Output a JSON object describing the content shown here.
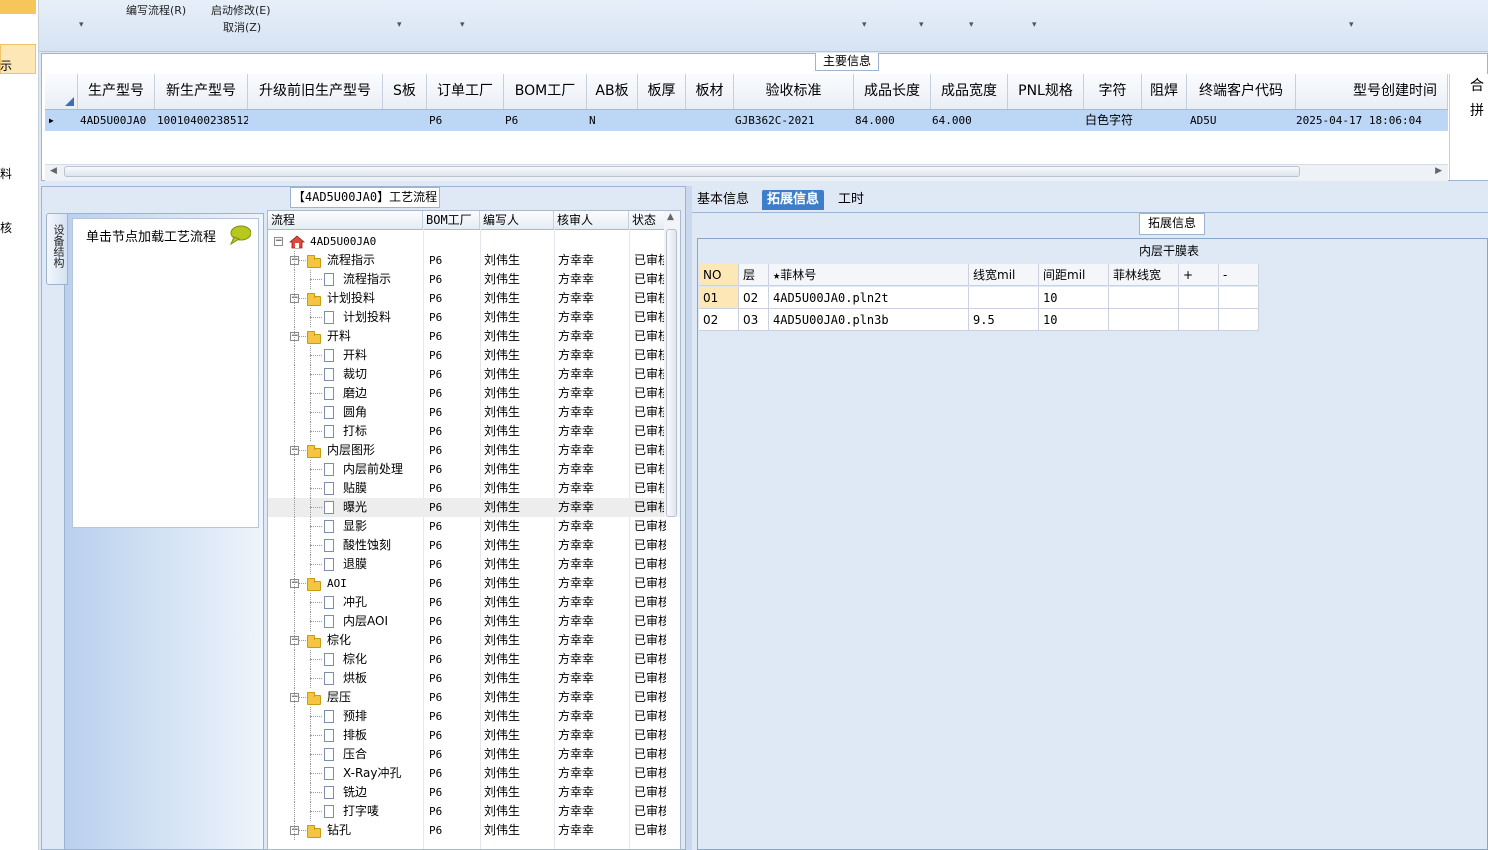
{
  "left_strip": {
    "items": [
      "示",
      "料",
      "核"
    ]
  },
  "ribbon": {
    "write_flow": "编写流程(R)",
    "start_modify": "启动修改(E)",
    "cancel": "取消(Z)"
  },
  "main_info": {
    "title": "主要信息",
    "columns": [
      "生产型号",
      "新生产型号",
      "升级前旧生产型号",
      "S板",
      "订单工厂",
      "BOM工厂",
      "AB板",
      "板厚",
      "板材",
      "验收标准",
      "成品长度",
      "成品宽度",
      "PNL规格",
      "字符",
      "阻焊",
      "终端客户代码",
      "型号创建时间",
      "合拼"
    ],
    "row": {
      "prod_model": "4AD5U00JA0",
      "new_model": "10010400238512",
      "old_model": "",
      "s_board": "",
      "order_factory": "P6",
      "bom_factory": "P6",
      "ab_board": "N",
      "thickness": "",
      "material": "",
      "standard": "GJB362C-2021",
      "length": "84.000",
      "width": "64.000",
      "pnl": "",
      "char": "白色字符",
      "solder": "",
      "customer_code": "AD5U",
      "created": "2025-04-17 18:06:04"
    }
  },
  "flow_panel": {
    "title": "【4AD5U00JA0】工艺流程",
    "vertical_tab": "设备结构",
    "nav_hint": "单击节点加载工艺流程",
    "columns": [
      "流程",
      "BOM工厂",
      "编写人",
      "核审人",
      "状态"
    ],
    "rows": [
      {
        "level": 0,
        "type": "root",
        "name": "4AD5U00JA0",
        "bom": "",
        "writer": "",
        "reviewer": "",
        "status": ""
      },
      {
        "level": 1,
        "type": "folder",
        "name": "流程指示",
        "bom": "P6",
        "writer": "刘伟生",
        "reviewer": "方幸幸",
        "status": "已审核"
      },
      {
        "level": 2,
        "type": "doc",
        "name": "流程指示",
        "bom": "P6",
        "writer": "刘伟生",
        "reviewer": "方幸幸",
        "status": "已审核"
      },
      {
        "level": 1,
        "type": "folder",
        "name": "计划投料",
        "bom": "P6",
        "writer": "刘伟生",
        "reviewer": "方幸幸",
        "status": "已审核"
      },
      {
        "level": 2,
        "type": "doc",
        "name": "计划投料",
        "bom": "P6",
        "writer": "刘伟生",
        "reviewer": "方幸幸",
        "status": "已审核"
      },
      {
        "level": 1,
        "type": "folder",
        "name": "开料",
        "bom": "P6",
        "writer": "刘伟生",
        "reviewer": "方幸幸",
        "status": "已审核"
      },
      {
        "level": 2,
        "type": "doc",
        "name": "开料",
        "bom": "P6",
        "writer": "刘伟生",
        "reviewer": "方幸幸",
        "status": "已审核"
      },
      {
        "level": 2,
        "type": "doc",
        "name": "裁切",
        "bom": "P6",
        "writer": "刘伟生",
        "reviewer": "方幸幸",
        "status": "已审核"
      },
      {
        "level": 2,
        "type": "doc",
        "name": "磨边",
        "bom": "P6",
        "writer": "刘伟生",
        "reviewer": "方幸幸",
        "status": "已审核"
      },
      {
        "level": 2,
        "type": "doc",
        "name": "圆角",
        "bom": "P6",
        "writer": "刘伟生",
        "reviewer": "方幸幸",
        "status": "已审核"
      },
      {
        "level": 2,
        "type": "doc",
        "name": "打标",
        "bom": "P6",
        "writer": "刘伟生",
        "reviewer": "方幸幸",
        "status": "已审核"
      },
      {
        "level": 1,
        "type": "folder",
        "name": "内层图形",
        "bom": "P6",
        "writer": "刘伟生",
        "reviewer": "方幸幸",
        "status": "已审核"
      },
      {
        "level": 2,
        "type": "doc",
        "name": "内层前处理",
        "bom": "P6",
        "writer": "刘伟生",
        "reviewer": "方幸幸",
        "status": "已审核"
      },
      {
        "level": 2,
        "type": "doc",
        "name": "贴膜",
        "bom": "P6",
        "writer": "刘伟生",
        "reviewer": "方幸幸",
        "status": "已审核"
      },
      {
        "level": 2,
        "type": "doc",
        "name": "曝光",
        "bom": "P6",
        "writer": "刘伟生",
        "reviewer": "方幸幸",
        "status": "已审核",
        "selected": true
      },
      {
        "level": 2,
        "type": "doc",
        "name": "显影",
        "bom": "P6",
        "writer": "刘伟生",
        "reviewer": "方幸幸",
        "status": "已审核"
      },
      {
        "level": 2,
        "type": "doc",
        "name": "酸性蚀刻",
        "bom": "P6",
        "writer": "刘伟生",
        "reviewer": "方幸幸",
        "status": "已审核"
      },
      {
        "level": 2,
        "type": "doc",
        "name": "退膜",
        "bom": "P6",
        "writer": "刘伟生",
        "reviewer": "方幸幸",
        "status": "已审核"
      },
      {
        "level": 1,
        "type": "folder",
        "name": "AOI",
        "bom": "P6",
        "writer": "刘伟生",
        "reviewer": "方幸幸",
        "status": "已审核"
      },
      {
        "level": 2,
        "type": "doc",
        "name": "冲孔",
        "bom": "P6",
        "writer": "刘伟生",
        "reviewer": "方幸幸",
        "status": "已审核"
      },
      {
        "level": 2,
        "type": "doc",
        "name": "内层AOI",
        "bom": "P6",
        "writer": "刘伟生",
        "reviewer": "方幸幸",
        "status": "已审核"
      },
      {
        "level": 1,
        "type": "folder",
        "name": "棕化",
        "bom": "P6",
        "writer": "刘伟生",
        "reviewer": "方幸幸",
        "status": "已审核"
      },
      {
        "level": 2,
        "type": "doc",
        "name": "棕化",
        "bom": "P6",
        "writer": "刘伟生",
        "reviewer": "方幸幸",
        "status": "已审核"
      },
      {
        "level": 2,
        "type": "doc",
        "name": "烘板",
        "bom": "P6",
        "writer": "刘伟生",
        "reviewer": "方幸幸",
        "status": "已审核"
      },
      {
        "level": 1,
        "type": "folder",
        "name": "层压",
        "bom": "P6",
        "writer": "刘伟生",
        "reviewer": "方幸幸",
        "status": "已审核"
      },
      {
        "level": 2,
        "type": "doc",
        "name": "预排",
        "bom": "P6",
        "writer": "刘伟生",
        "reviewer": "方幸幸",
        "status": "已审核"
      },
      {
        "level": 2,
        "type": "doc",
        "name": "排板",
        "bom": "P6",
        "writer": "刘伟生",
        "reviewer": "方幸幸",
        "status": "已审核"
      },
      {
        "level": 2,
        "type": "doc",
        "name": "压合",
        "bom": "P6",
        "writer": "刘伟生",
        "reviewer": "方幸幸",
        "status": "已审核"
      },
      {
        "level": 2,
        "type": "doc",
        "name": "X-Ray冲孔",
        "bom": "P6",
        "writer": "刘伟生",
        "reviewer": "方幸幸",
        "status": "已审核"
      },
      {
        "level": 2,
        "type": "doc",
        "name": "铣边",
        "bom": "P6",
        "writer": "刘伟生",
        "reviewer": "方幸幸",
        "status": "已审核"
      },
      {
        "level": 2,
        "type": "doc",
        "name": "打字唛",
        "bom": "P6",
        "writer": "刘伟生",
        "reviewer": "方幸幸",
        "status": "已审核"
      },
      {
        "level": 1,
        "type": "folder",
        "name": "钻孔",
        "bom": "P6",
        "writer": "刘伟生",
        "reviewer": "方幸幸",
        "status": "已审核"
      }
    ]
  },
  "right_panel": {
    "tabs": [
      "基本信息",
      "拓展信息",
      "工时"
    ],
    "active_tab": "拓展信息",
    "section_title": "拓展信息",
    "table_title": "内层干膜表",
    "columns": [
      "NO",
      "层",
      "★菲林号",
      "线宽mil",
      "间距mil",
      "菲林线宽",
      "+",
      "-"
    ],
    "rows": [
      [
        "01",
        "02",
        "4AD5U00JA0.pln2t",
        "",
        "10",
        "",
        "",
        ""
      ],
      [
        "02",
        "03",
        "4AD5U00JA0.pln3b",
        "9.5",
        "10",
        "",
        "",
        ""
      ]
    ]
  },
  "colors": {
    "accent": "#3d7ec8",
    "selected_row": "#bcd6f6",
    "panel_bg": "#dfe9f5",
    "folder": "#f5c542"
  }
}
